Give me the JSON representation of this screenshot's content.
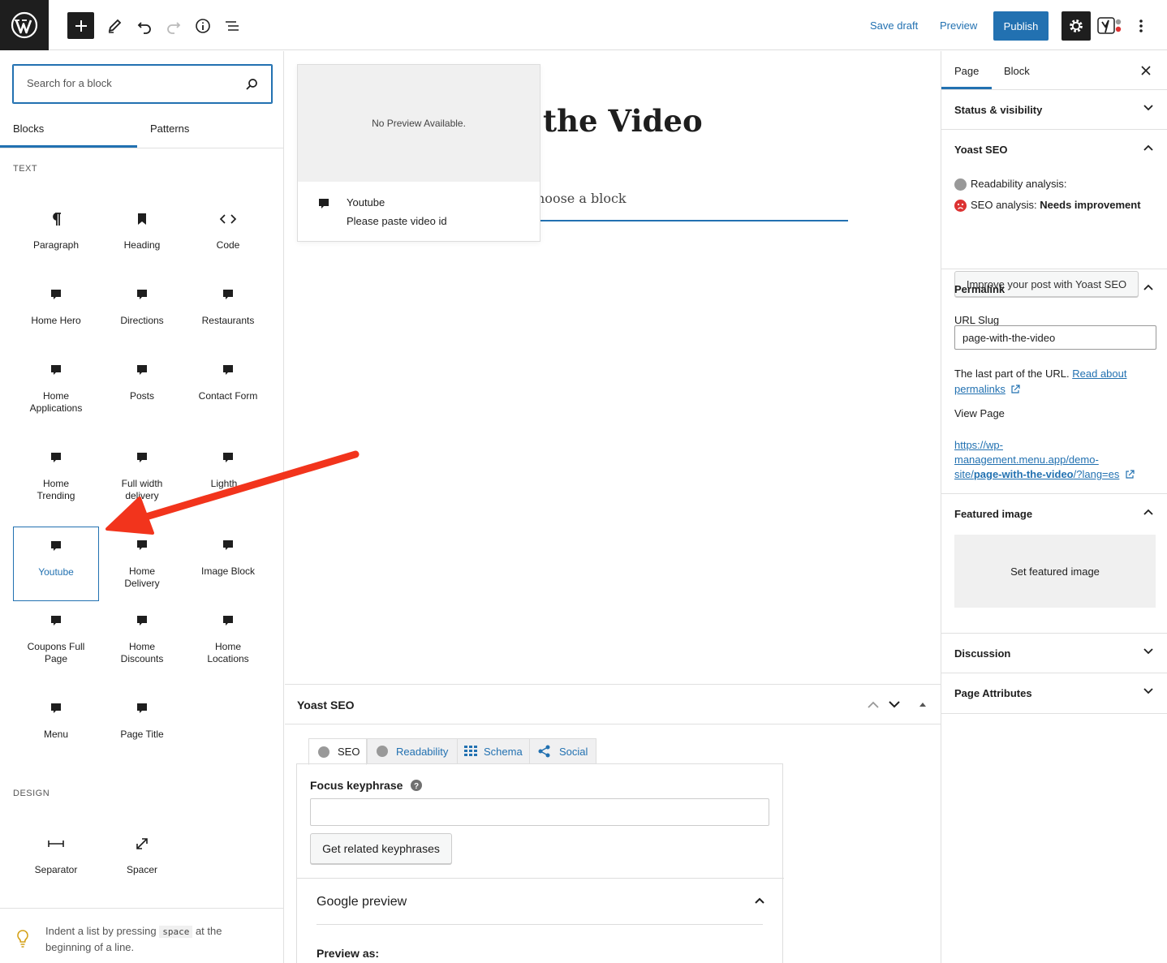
{
  "toolbar": {
    "save_draft": "Save draft",
    "preview": "Preview",
    "publish": "Publish"
  },
  "inserter": {
    "search_placeholder": "Search for a block",
    "tabs": [
      "Blocks",
      "Patterns"
    ],
    "categories": {
      "text": "TEXT",
      "design": "DESIGN"
    },
    "text_blocks": [
      {
        "label": "Paragraph",
        "icon": "paragraph-icon"
      },
      {
        "label": "Heading",
        "icon": "bookmark-icon"
      },
      {
        "label": "Code",
        "icon": "code-icon"
      },
      {
        "label": "Home Hero",
        "icon": "comment-icon"
      },
      {
        "label": "Directions",
        "icon": "comment-icon"
      },
      {
        "label": "Restaurants",
        "icon": "comment-icon"
      },
      {
        "label": "Home Applications",
        "icon": "comment-icon"
      },
      {
        "label": "Posts",
        "icon": "comment-icon"
      },
      {
        "label": "Contact Form",
        "icon": "comment-icon"
      },
      {
        "label": "Home Trending",
        "icon": "comment-icon"
      },
      {
        "label": "Full width delivery",
        "icon": "comment-icon"
      },
      {
        "label": "Lighth...",
        "icon": "comment-icon"
      },
      {
        "label": "Youtube",
        "icon": "comment-icon",
        "selected": true
      },
      {
        "label": "Home Delivery",
        "icon": "comment-icon"
      },
      {
        "label": "Image Block",
        "icon": "comment-icon"
      },
      {
        "label": "Coupons Full Page",
        "icon": "comment-icon"
      },
      {
        "label": "Home Discounts",
        "icon": "comment-icon"
      },
      {
        "label": "Home Locations",
        "icon": "comment-icon"
      },
      {
        "label": "Menu",
        "icon": "comment-icon"
      },
      {
        "label": "Page Title",
        "icon": "comment-icon"
      }
    ],
    "design_blocks": [
      {
        "label": "Separator",
        "icon": "separator-icon"
      },
      {
        "label": "Spacer",
        "icon": "spacer-icon"
      }
    ],
    "tip": {
      "before": "Indent a list by pressing",
      "key": "space",
      "after": "at the beginning of a line."
    }
  },
  "editor": {
    "title_fragment": "the Video",
    "placeholder_fragment": "noose a block",
    "preview": {
      "no_preview": "No Preview Available.",
      "block_title": "Youtube",
      "block_desc": "Please paste video id"
    }
  },
  "yoast_panel": {
    "title": "Yoast SEO",
    "tabs": [
      "SEO",
      "Readability",
      "Schema",
      "Social"
    ],
    "focus_label": "Focus keyphrase",
    "related_button": "Get related keyphrases",
    "google_preview": "Google preview",
    "preview_as": "Preview as:"
  },
  "sidebar": {
    "tabs": [
      "Page",
      "Block"
    ],
    "status_visibility": "Status & visibility",
    "yoast": {
      "title": "Yoast SEO",
      "readability": "Readability analysis:",
      "seo_label": "SEO analysis:",
      "seo_value": "Needs improvement",
      "button": "Improve your post with Yoast SEO"
    },
    "permalink": {
      "title": "Permalink",
      "url_slug_label": "URL Slug",
      "slug": "page-with-the-video",
      "help_before": "The last part of the URL.",
      "help_link_1": "Read about",
      "help_link_2": "permalinks",
      "view_page": "View Page",
      "url_line1": "https://wp-",
      "url_line2": "management.menu.app/demo-",
      "url_line3_pre": "site/",
      "url_line3_bold": "page-with-the-video",
      "url_line3_post": "/?lang=es"
    },
    "featured": {
      "title": "Featured image",
      "button": "Set featured image"
    },
    "discussion": "Discussion",
    "page_attributes": "Page Attributes"
  },
  "colors": {
    "accent": "#2271b1",
    "dark": "#1e1e1e",
    "annotation_arrow": "#f2341c",
    "error": "#dc3232"
  }
}
